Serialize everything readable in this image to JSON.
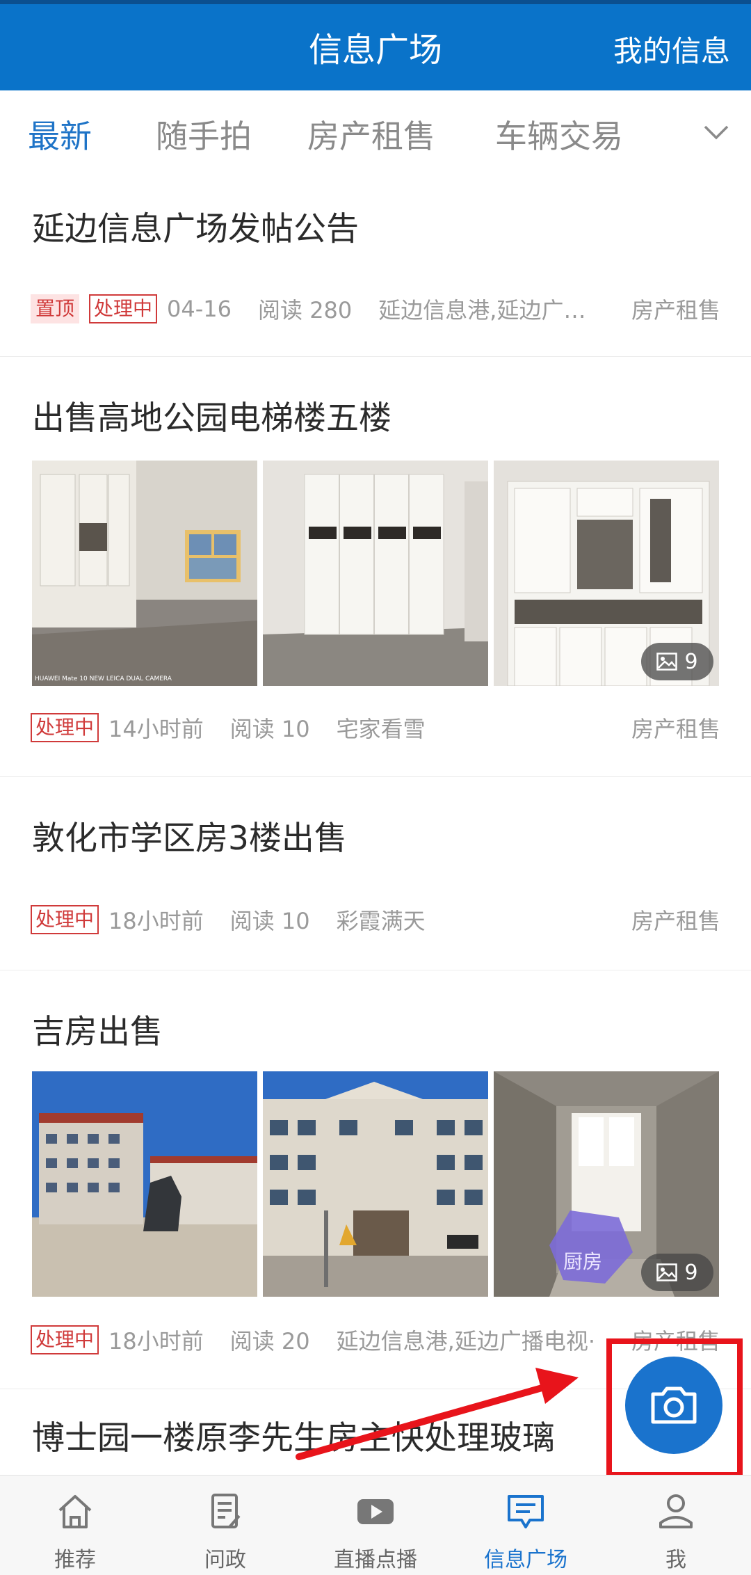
{
  "header": {
    "title": "信息广场",
    "right_action": "我的信息"
  },
  "tabs": [
    {
      "label": "最新",
      "active": true
    },
    {
      "label": "随手拍",
      "active": false
    },
    {
      "label": "房产租售",
      "active": false
    },
    {
      "label": "车辆交易",
      "active": false
    }
  ],
  "posts": [
    {
      "title": "延边信息广场发帖公告",
      "tags": [
        "置顶",
        "处理中"
      ],
      "time": "04-16",
      "reads": "阅读 280",
      "source": "延边信息港,延边广播…",
      "category": "房产租售"
    },
    {
      "title": "出售高地公园电梯楼五楼",
      "tags": [
        "处理中"
      ],
      "time": "14小时前",
      "reads": "阅读 10",
      "source": "宅家看雪",
      "category": "房产租售",
      "image_count": "9",
      "watermark": "HUAWEI Mate 10 NEW LEICA DUAL CAMERA"
    },
    {
      "title": "敦化市学区房3楼出售",
      "tags": [
        "处理中"
      ],
      "time": "18小时前",
      "reads": "阅读 10",
      "source": "彩霞满天",
      "category": "房产租售"
    },
    {
      "title": "吉房出售",
      "tags": [
        "处理中"
      ],
      "time": "18小时前",
      "reads": "阅读 20",
      "source": "延边信息港,延边广播电视·",
      "category": "房产租售",
      "image_count": "9",
      "image_label": "厨房"
    },
    {
      "title": "博士园一楼原李先生房主快处理玻璃"
    }
  ],
  "nav": [
    {
      "label": "推荐",
      "icon": "home-icon",
      "active": false
    },
    {
      "label": "问政",
      "icon": "document-icon",
      "active": false
    },
    {
      "label": "直播点播",
      "icon": "play-icon",
      "active": false
    },
    {
      "label": "信息广场",
      "icon": "chat-icon",
      "active": true
    },
    {
      "label": "我",
      "icon": "person-icon",
      "active": false
    }
  ],
  "fab": {
    "icon": "camera-icon"
  },
  "colors": {
    "primary": "#0a73c9",
    "highlight_frame": "#e8141b",
    "tag_red": "#d03a3a"
  }
}
